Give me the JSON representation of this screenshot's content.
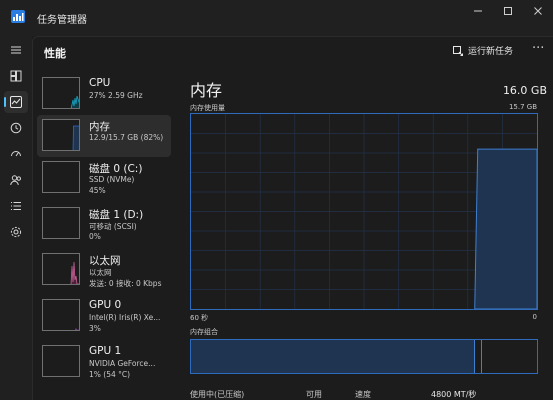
{
  "window": {
    "title": "任务管理器",
    "min_icon": "minimize-icon",
    "max_icon": "maximize-icon",
    "close_icon": "close-icon"
  },
  "rail": {
    "items": [
      {
        "icon": "hamburger-menu-icon"
      },
      {
        "icon": "processes-icon"
      },
      {
        "icon": "performance-icon",
        "active": true
      },
      {
        "icon": "app-history-icon"
      },
      {
        "icon": "startup-apps-icon"
      },
      {
        "icon": "users-icon"
      },
      {
        "icon": "details-icon"
      },
      {
        "icon": "services-icon"
      }
    ]
  },
  "header": {
    "title": "性能",
    "run_task_label": "运行新任务",
    "more_label": "···"
  },
  "devices": [
    {
      "name": "CPU",
      "sub": "27% 2.59 GHz",
      "val": "",
      "color": "#17a9c9",
      "active": false
    },
    {
      "name": "内存",
      "sub": "12.9/15.7 GB (82%)",
      "val": "",
      "color": "#2f6bbd",
      "active": true
    },
    {
      "name": "磁盘 0 (C:)",
      "sub": "SSD (NVMe)",
      "val": "45%",
      "color": "#4ca641",
      "active": false
    },
    {
      "name": "磁盘 1 (D:)",
      "sub": "可移动 (SCSI)",
      "val": "0%",
      "color": "#4ca641",
      "active": false
    },
    {
      "name": "以太网",
      "sub": "以太网",
      "val": "发送: 0 接收: 0 Kbps",
      "color": "#c9609a",
      "active": false
    },
    {
      "name": "GPU 0",
      "sub": "Intel(R) Iris(R) Xe...",
      "val": "3%",
      "color": "#9b4fc9",
      "active": false
    },
    {
      "name": "GPU 1",
      "sub": "NVIDIA GeForce...",
      "val": "1% (54 °C)",
      "color": "#9b4fc9",
      "active": false
    }
  ],
  "detail": {
    "title": "内存",
    "total": "16.0 GB",
    "graph_label": "内存使用量",
    "graph_max": "15.7 GB",
    "axis_left": "60 秒",
    "axis_right": "0",
    "composition_label": "内存组合",
    "memory_usage": {
      "fill_start_fraction": 0.82,
      "level": 0.82
    },
    "composition": {
      "in_use_fraction": 0.82,
      "modified_fraction": 0.84
    },
    "stats": [
      {
        "label": "使用中(已压缩)"
      },
      {
        "label": "可用"
      },
      {
        "label": "速度",
        "value": "4800 MT/秒"
      }
    ]
  },
  "colors": {
    "accent": "#4cc2ff",
    "memory": "#2f6bbd",
    "memory_fill": "#1e3450"
  }
}
